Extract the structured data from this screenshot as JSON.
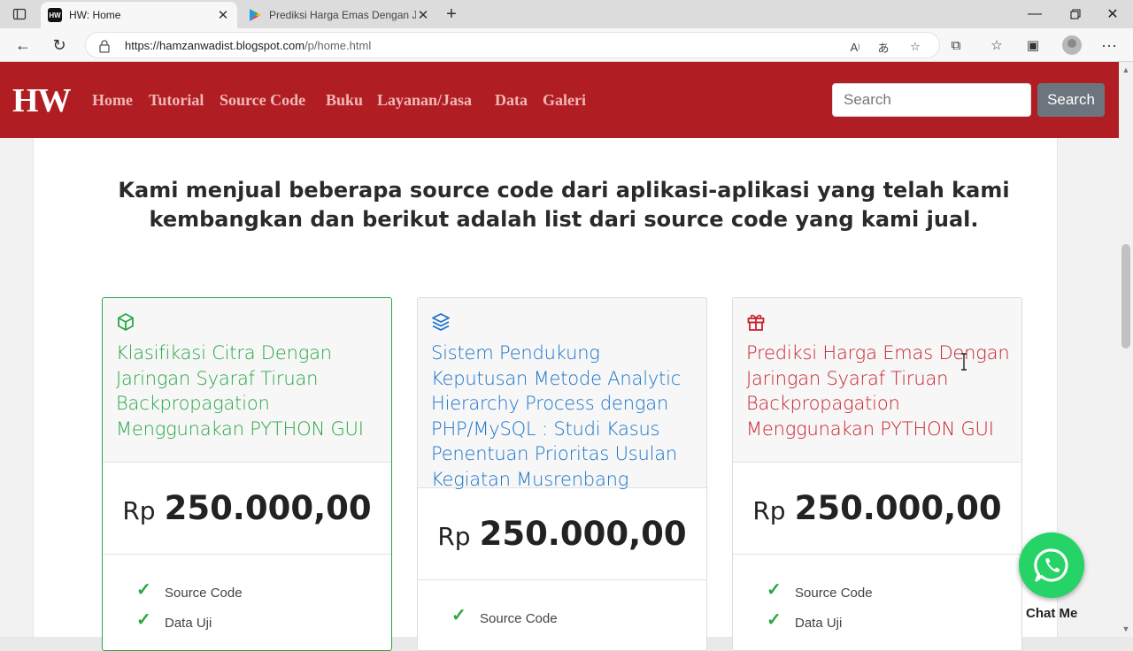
{
  "browser": {
    "tabs": [
      {
        "title": "HW: Home",
        "favicon_text": "HW"
      },
      {
        "title": "Prediksi Harga Emas Dengan Jari"
      }
    ],
    "url_host": "https://hamzanwadist.blogspot.com",
    "url_path": "/p/home.html"
  },
  "site": {
    "brand": "HW",
    "nav": [
      "Home",
      "Tutorial",
      "Source Code",
      "Buku",
      "Layanan/Jasa",
      "Data",
      "Galeri"
    ],
    "search_placeholder": "Search",
    "search_button": "Search"
  },
  "headline": "Kami menjual beberapa source code dari aplikasi-aplikasi yang telah kami kembangkan dan berikut adalah list dari source code yang kami jual.",
  "cards": [
    {
      "icon": "box-icon",
      "title": "Klasifikasi Citra Dengan Jaringan Syaraf Tiruan Backpropagation Menggunakan PYTHON GUI",
      "currency": "Rp",
      "price": "250.000,00",
      "features": [
        "Source Code",
        "Data Uji"
      ],
      "color": "#28a745"
    },
    {
      "icon": "layers-icon",
      "title": "Sistem Pendukung Keputusan Metode Analytic Hierarchy Process dengan PHP/MySQL : Studi Kasus Penentuan Prioritas Usulan Kegiatan Musrenbang",
      "currency": "Rp",
      "price": "250.000,00",
      "features": [
        "Source Code"
      ],
      "color": "#1a73c8"
    },
    {
      "icon": "gift-icon",
      "title": "Prediksi Harga Emas Dengan Jaringan Syaraf Tiruan Backpropagation Menggunakan PYTHON GUI",
      "currency": "Rp",
      "price": "250.000,00",
      "features": [
        "Source Code",
        "Data Uji"
      ],
      "color": "#c8232c"
    }
  ],
  "chat": {
    "label": "Chat Me"
  }
}
